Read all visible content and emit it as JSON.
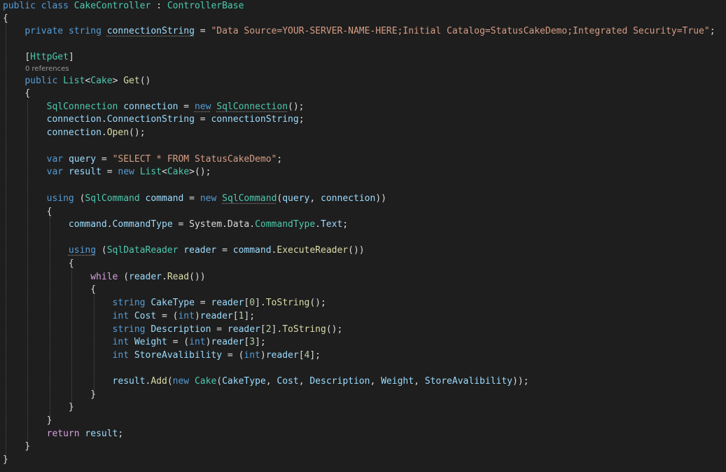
{
  "code": {
    "l1": {
      "kw1": "public",
      "kw2": "class",
      "cls": "CakeController",
      "sep": " : ",
      "base": "ControllerBase"
    },
    "l2": {
      "brace": "{"
    },
    "l3": {
      "kw1": "private",
      "kw2": "string",
      "var": "connectionString",
      "eq": " = ",
      "str": "\"Data Source=YOUR-SERVER-NAME-HERE;Initial Catalog=StatusCakeDemo;Integrated Security=True\"",
      "semi": ";"
    },
    "l5": {
      "ob": "[",
      "attr": "HttpGet",
      "cb": "]"
    },
    "lens": "0 references",
    "l6": {
      "kw1": "public",
      "type": "List",
      "lt": "<",
      "targ": "Cake",
      "gt": ">",
      "method": "Get",
      "parens": "()"
    },
    "l7": {
      "brace": "{"
    },
    "l8": {
      "type": "SqlConnection",
      "var": "connection",
      "eq": " = ",
      "kw": "new",
      "ctor": "SqlConnection",
      "tail": "();"
    },
    "l9": {
      "var1": "connection",
      "dot": ".",
      "prop": "ConnectionString",
      "eq": " = ",
      "var2": "connectionString",
      "semi": ";"
    },
    "l10": {
      "var": "connection",
      "dot": ".",
      "method": "Open",
      "tail": "();"
    },
    "l12": {
      "kw": "var",
      "var": "query",
      "eq": " = ",
      "str": "\"SELECT * FROM StatusCakeDemo\"",
      "semi": ";"
    },
    "l13": {
      "kw": "var",
      "var": "result",
      "eq": " = ",
      "kw2": "new",
      "type": "List",
      "lt": "<",
      "targ": "Cake",
      "tail": ">();"
    },
    "l15": {
      "kw": "using",
      "op": " (",
      "type": "SqlCommand",
      "var": "command",
      "eq": " = ",
      "kw2": "new",
      "ctor": "SqlCommand",
      "po": "(",
      "a1": "query",
      "comma": ", ",
      "a2": "connection",
      "tail": "))"
    },
    "l16": {
      "brace": "{"
    },
    "l17": {
      "var": "command",
      "d1": ".",
      "prop": "CommandType",
      "eq": " = ",
      "ns1": "System",
      "d2": ".",
      "ns2": "Data",
      "d3": ".",
      "enumType": "CommandType",
      "d4": ".",
      "enumVal": "Text",
      "semi": ";"
    },
    "l19": {
      "kw": "using",
      "op": " (",
      "type": "SqlDataReader",
      "var": "reader",
      "eq": " = ",
      "var2": "command",
      "dot": ".",
      "method": "ExecuteReader",
      "tail": "())"
    },
    "l20": {
      "brace": "{"
    },
    "l21": {
      "kw": "while",
      "op": " (",
      "var": "reader",
      "dot": ".",
      "method": "Read",
      "tail": "())"
    },
    "l22": {
      "brace": "{"
    },
    "l23": {
      "kw": "string",
      "var": "CakeType",
      "eq": " = ",
      "var2": "reader",
      "ob": "[",
      "idx": "0",
      "cb": "].",
      "method": "ToString",
      "tail": "();"
    },
    "l24": {
      "kw": "int",
      "var": "Cost",
      "eq": " = (",
      "kw2": "int",
      "cp": ")",
      "var2": "reader",
      "ob": "[",
      "idx": "1",
      "tail": "];"
    },
    "l25": {
      "kw": "string",
      "var": "Description",
      "eq": " = ",
      "var2": "reader",
      "ob": "[",
      "idx": "2",
      "cb": "].",
      "method": "ToString",
      "tail": "();"
    },
    "l26": {
      "kw": "int",
      "var": "Weight",
      "eq": " = (",
      "kw2": "int",
      "cp": ")",
      "var2": "reader",
      "ob": "[",
      "idx": "3",
      "tail": "];"
    },
    "l27": {
      "kw": "int",
      "var": "StoreAvalibility",
      "eq": " = (",
      "kw2": "int",
      "cp": ")",
      "var2": "reader",
      "ob": "[",
      "idx": "4",
      "tail": "];"
    },
    "l29": {
      "var": "result",
      "dot": ".",
      "method": "Add",
      "po": "(",
      "kw": "new",
      "type": "Cake",
      "po2": "(",
      "a1": "CakeType",
      "c1": ", ",
      "a2": "Cost",
      "c2": ", ",
      "a3": "Description",
      "c3": ", ",
      "a4": "Weight",
      "c4": ", ",
      "a5": "StoreAvalibility",
      "tail": "));"
    },
    "l30": {
      "brace": "}"
    },
    "l31": {
      "brace": "}"
    },
    "l32": {
      "brace": "}"
    },
    "l33": {
      "kw": "return",
      "var": "result",
      "semi": ";"
    },
    "l34": {
      "brace": "}"
    },
    "l35": {
      "brace": "}"
    }
  }
}
